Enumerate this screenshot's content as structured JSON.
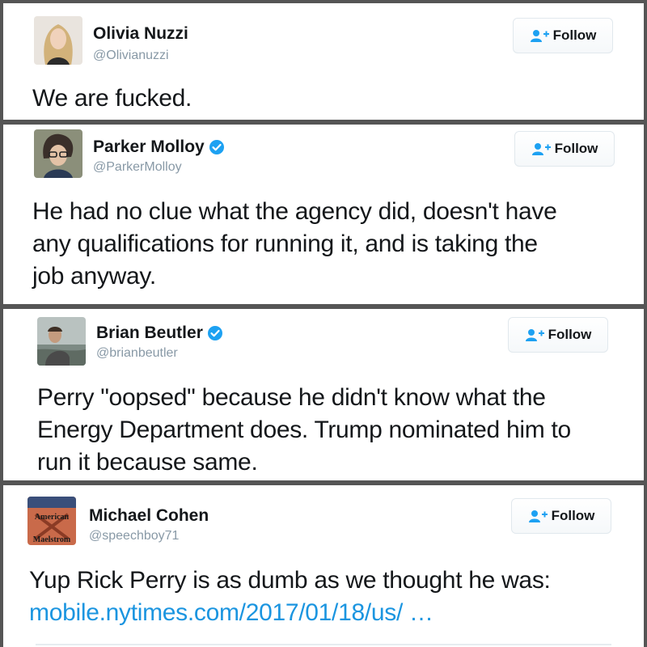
{
  "tweets": [
    {
      "name": "Olivia Nuzzi",
      "handle": "@Olivianuzzi",
      "verified": false,
      "follow_label": "Follow",
      "lines": [
        "We are fucked."
      ]
    },
    {
      "name": "Parker Molloy",
      "handle": "@ParkerMolloy",
      "verified": true,
      "follow_label": "Follow",
      "lines": [
        "He had no clue what the agency did, doesn't have",
        "any qualifications for running it, and is taking the",
        "job anyway."
      ]
    },
    {
      "name": "Brian Beutler",
      "handle": "@brianbeutler",
      "verified": true,
      "follow_label": "Follow",
      "lines": [
        "Perry \"oopsed\" because he didn't know what the",
        "Energy Department does. Trump nominated him to",
        "run it because same."
      ]
    },
    {
      "name": "Michael Cohen",
      "handle": "@speechboy71",
      "verified": false,
      "follow_label": "Follow",
      "lines": [
        "Yup Rick Perry is as dumb as we thought he was:"
      ],
      "link": "mobile.nytimes.com/2017/01/18/us/  …",
      "avatar_text": [
        "American",
        "Maelstrom"
      ]
    }
  ],
  "colors": {
    "link": "#1b95e0",
    "verified": "#1da1f2",
    "follow_icon": "#1da1f2",
    "handle": "#8899a6"
  }
}
